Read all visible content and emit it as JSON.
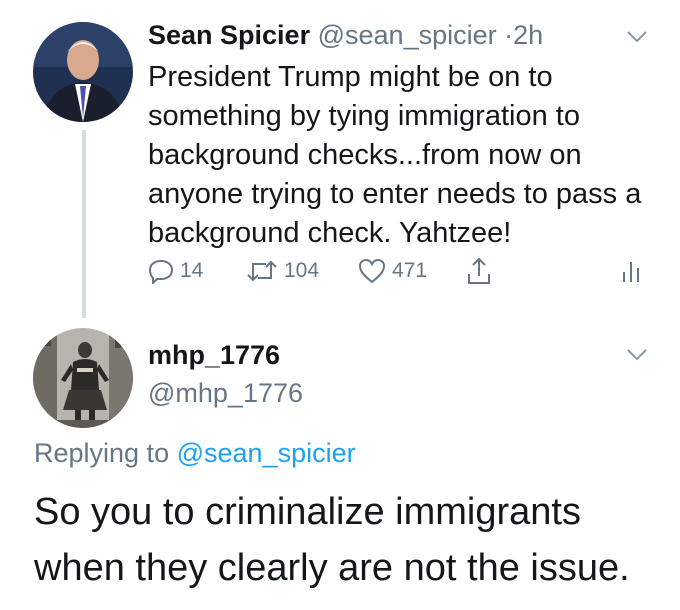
{
  "tweet1": {
    "name": "Sean Spicier",
    "handle": "@sean_spicier",
    "time_separator": "·",
    "time": "2h",
    "text": "President Trump might be on to something by tying immigration to background checks...from now on anyone trying to enter needs to pass a background check. Yahtzee!",
    "reply_count": "14",
    "retweet_count": "104",
    "like_count": "471"
  },
  "tweet2": {
    "name": "mhp_1776",
    "handle": "@mhp_1776",
    "replying_prefix": "Replying to",
    "replying_to": "@sean_spicier",
    "text": "So you to criminalize immigrants when they clearly are not the issue."
  },
  "colors": {
    "muted": "#657786",
    "link": "#1da1f2",
    "text": "#14171a",
    "thread": "#d5dde3"
  },
  "icons": [
    "reply-icon",
    "retweet-icon",
    "like-icon",
    "share-icon",
    "analytics-icon",
    "chevron-down-icon"
  ]
}
